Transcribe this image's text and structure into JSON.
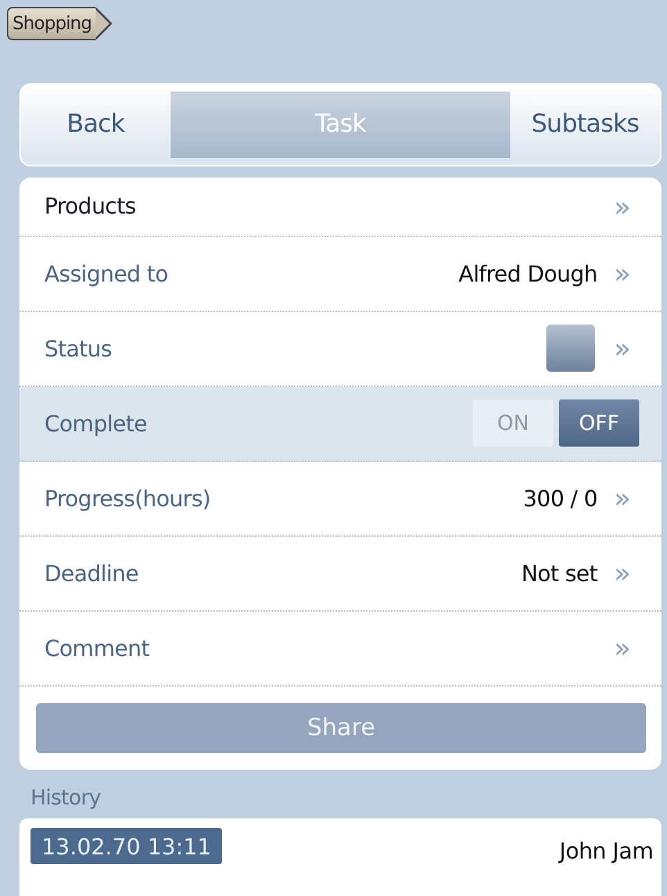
{
  "breadcrumb": {
    "label": "Shopping"
  },
  "tabs": [
    {
      "label": "Back",
      "selected": false
    },
    {
      "label": "Task",
      "selected": true
    },
    {
      "label": "Subtasks",
      "selected": false
    }
  ],
  "rows": [
    {
      "kind": "link",
      "label": "Products",
      "chevron": "»"
    },
    {
      "kind": "value",
      "label": "Assigned to",
      "value": "Alfred Dough",
      "chevron": "»"
    },
    {
      "kind": "status",
      "label": "Status",
      "chevron": "»"
    },
    {
      "kind": "toggle",
      "label": "Complete",
      "on_label": "ON",
      "off_label": "OFF",
      "on": false
    },
    {
      "kind": "value",
      "label": "Progress(hours)",
      "value": "300 / 0",
      "chevron": "»"
    },
    {
      "kind": "value",
      "label": "Deadline",
      "value": "Not set",
      "chevron": "»"
    },
    {
      "kind": "link",
      "label": "Comment",
      "chevron": "»"
    }
  ],
  "share_button": "Share",
  "history": {
    "title": "History",
    "entries": [
      {
        "time": "13.02.70 13:11",
        "user": "John Jam"
      }
    ]
  }
}
